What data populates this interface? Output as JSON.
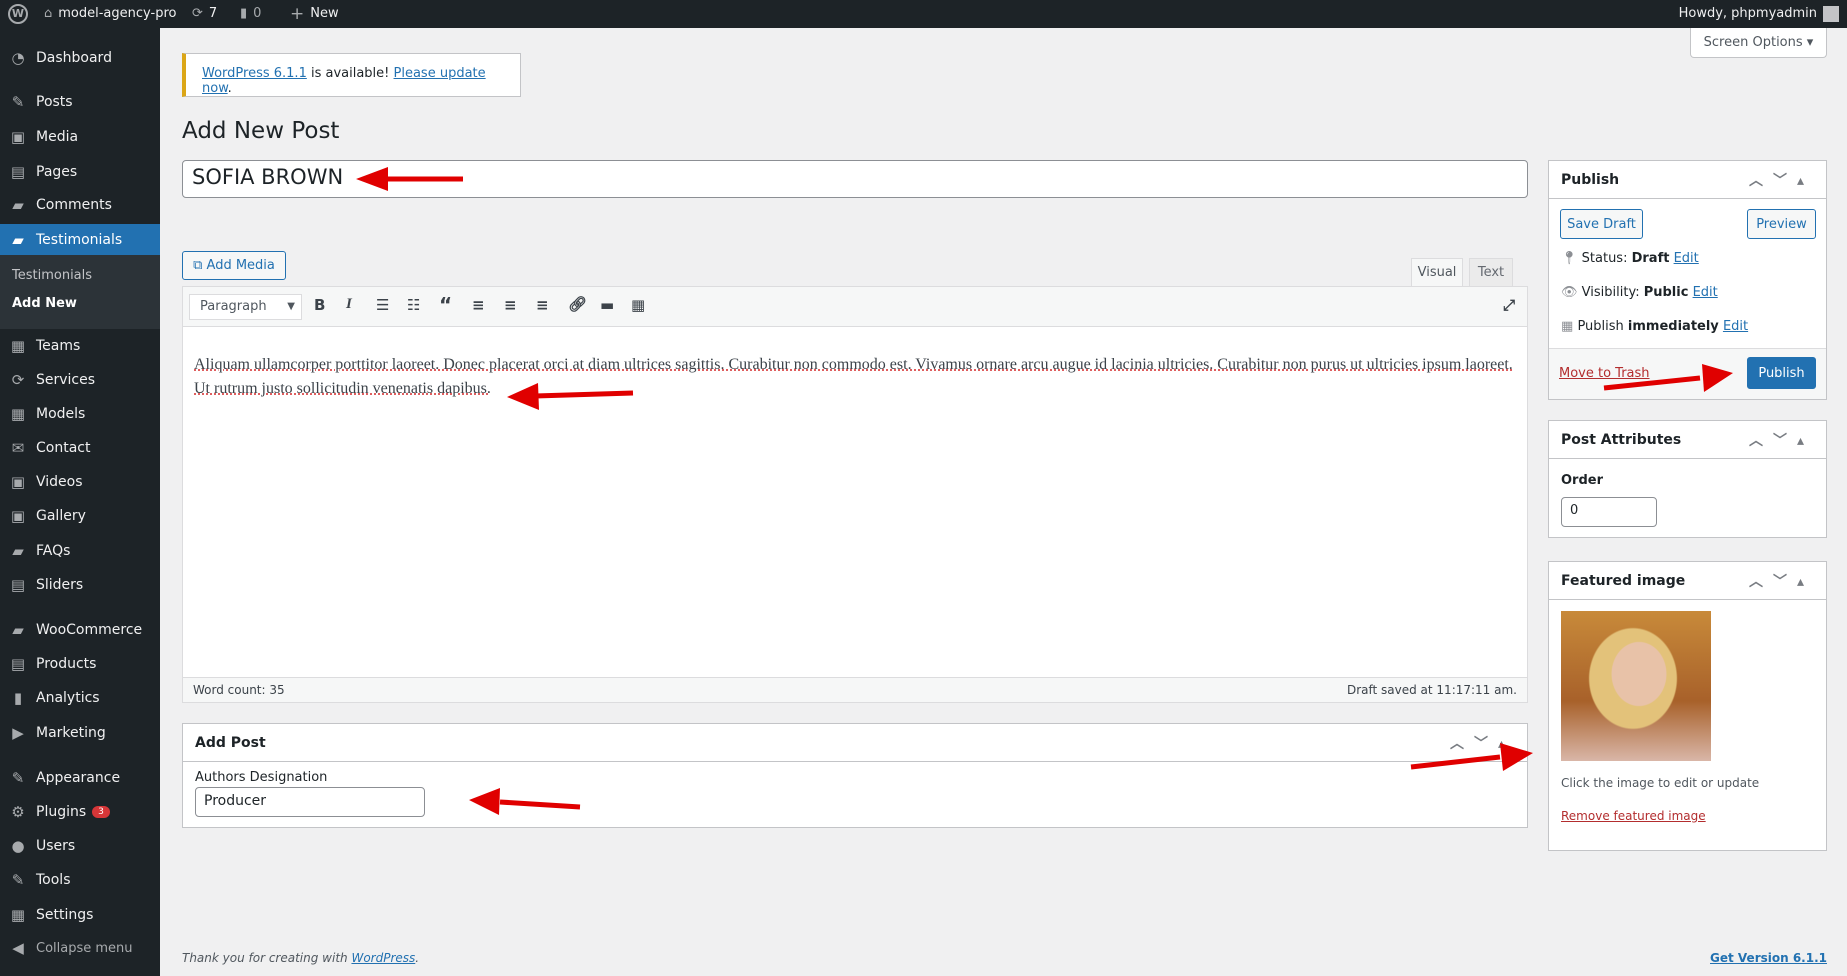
{
  "adminbar": {
    "site": "model-agency-pro",
    "updates": "7",
    "comments": "0",
    "new": "New",
    "howdy": "Howdy, phpmyadmin"
  },
  "sidebar": {
    "items": [
      "Dashboard",
      "Posts",
      "Media",
      "Pages",
      "Comments",
      "Testimonials",
      "Teams",
      "Services",
      "Models",
      "Contact",
      "Videos",
      "Gallery",
      "FAQs",
      "Sliders",
      "WooCommerce",
      "Products",
      "Analytics",
      "Marketing",
      "Appearance",
      "Plugins",
      "Users",
      "Tools",
      "Settings",
      "Collapse menu"
    ],
    "submenu": [
      "Testimonials",
      "Add New"
    ],
    "plugins_badge": "3"
  },
  "screen_options": "Screen Options",
  "notice": {
    "link1": "WordPress 6.1.1",
    "text": " is available! ",
    "link2": "Please update now",
    "end": "."
  },
  "page_title": "Add New Post",
  "post_title": "SOFIA  BROWN",
  "editor": {
    "add_media": "Add Media",
    "tab_visual": "Visual",
    "tab_text": "Text",
    "format": "Paragraph",
    "content_line1": "Aliquam ullamcorper porttitor laoreet. Donec placerat orci at diam ultrices sagittis. Curabitur non commodo est. Vivamus ornare arcu augue id lacinia ultricies. Curabitur non purus ut ultricies ipsum laoreet.",
    "content_line2": "Ut rutrum justo sollicitudin venenatis dapibus.",
    "word_count": "Word count: 35",
    "draft_saved": "Draft saved at 11:17:11 am."
  },
  "add_post": {
    "title": "Add Post",
    "field_label": "Authors Designation",
    "field_value": "Producer"
  },
  "publish": {
    "title": "Publish",
    "save_draft": "Save Draft",
    "preview": "Preview",
    "status_label": "Status: ",
    "status": "Draft",
    "visibility_label": "Visibility: ",
    "visibility": "Public",
    "publish_label": "Publish ",
    "publish_when": "immediately",
    "edit": "Edit",
    "trash": "Move to Trash",
    "publish_btn": "Publish"
  },
  "attributes": {
    "title": "Post Attributes",
    "order_label": "Order",
    "order_value": "0"
  },
  "featured": {
    "title": "Featured image",
    "hint": "Click the image to edit or update",
    "remove": "Remove featured image"
  },
  "footer": {
    "thanks": "Thank you for creating with ",
    "wp": "WordPress",
    "end": ".",
    "version": "Get Version 6.1.1"
  },
  "colors": {
    "accent": "#2271b1",
    "adminbar": "#1d2327",
    "arrow": "#e00000"
  }
}
